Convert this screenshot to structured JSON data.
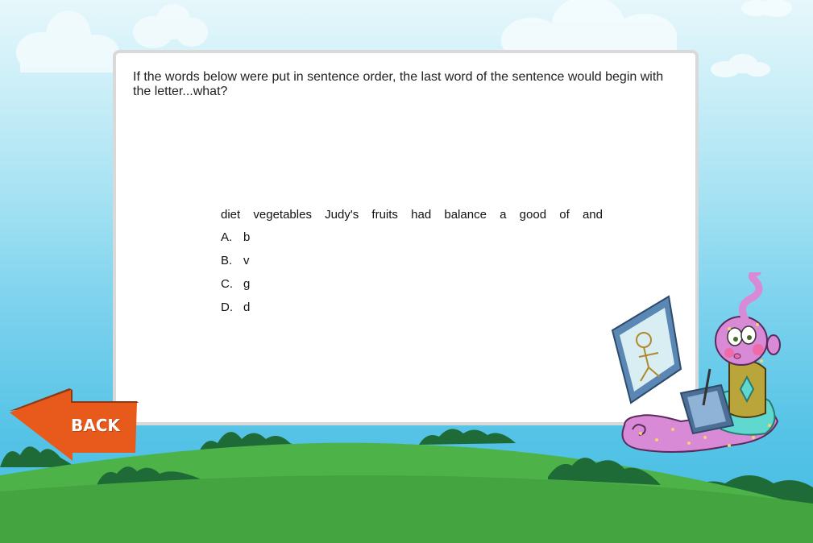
{
  "question": {
    "prompt": "If the words below were put in sentence order, the last word of the sentence would begin with the letter...what?",
    "words": [
      "diet",
      "vegetables",
      "Judy's",
      "fruits",
      "had",
      "balance",
      "a",
      "good",
      "of",
      "and"
    ],
    "options": [
      {
        "letter": "A.",
        "text": "b"
      },
      {
        "letter": "B.",
        "text": "v"
      },
      {
        "letter": "C.",
        "text": "g"
      },
      {
        "letter": "D.",
        "text": "d"
      }
    ]
  },
  "navigation": {
    "back_label": "BACK"
  },
  "colors": {
    "back_arrow": "#e85a1c",
    "grass_light": "#4db348",
    "grass_dark": "#44a43f",
    "bush": "#1e6b37",
    "sky_bottom": "#45bde4",
    "card_border": "#d9d9d9",
    "mascot_pink": "#d98ad6"
  }
}
